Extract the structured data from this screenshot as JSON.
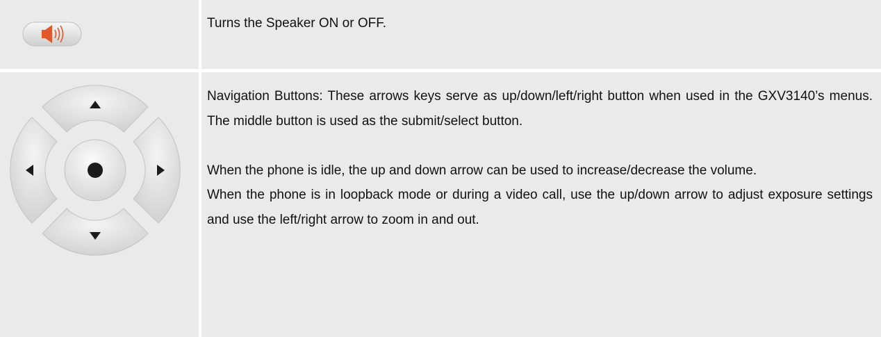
{
  "rows": [
    {
      "icon": "speaker-button-icon",
      "lines": [
        "Turns the Speaker ON or OFF."
      ]
    },
    {
      "icon": "navigation-pad-icon",
      "paragraph1": "Navigation Buttons: These arrows keys serve as up/down/left/right button when used in the GXV3140’s menus. The middle button is used as the submit/select button.",
      "paragraph2": "When the phone is idle, the up and down arrow can be used to increase/decrease the volume.",
      "paragraph3": "When the phone is in loopback mode or during a video call, use the up/down arrow to adjust exposure settings and use the left/right arrow to zoom in and out."
    }
  ],
  "colors": {
    "cell_background": "#eaeaea",
    "speaker_accent": "#e2582c",
    "pad_button": "#d9d9d9",
    "arrow": "#1b1b1b"
  }
}
